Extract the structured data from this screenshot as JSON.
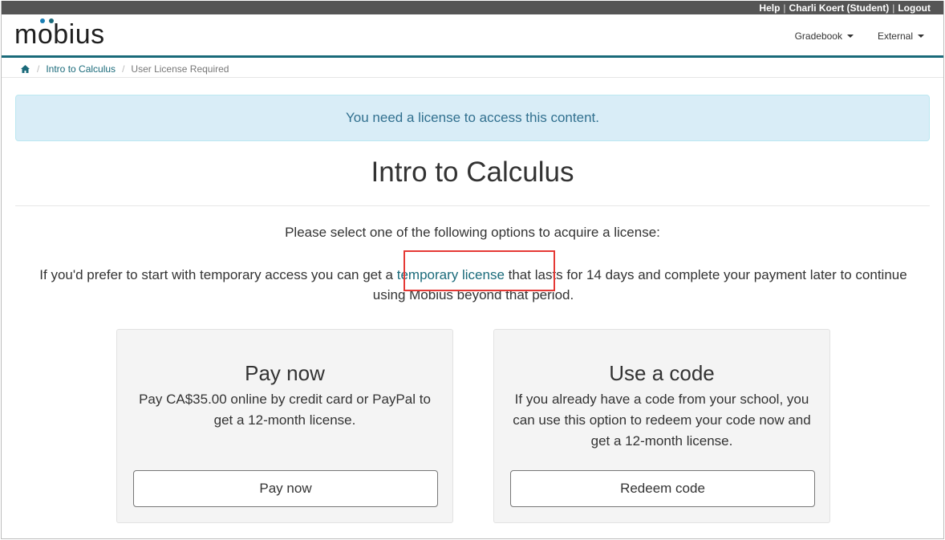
{
  "topbar": {
    "help": "Help",
    "user": "Charli Koert (Student)",
    "logout": "Logout",
    "separator": "|"
  },
  "brand": {
    "logo_text_pre": "m",
    "logo_text_o": "o",
    "logo_text_post": "bius",
    "dot_colors": [
      "#1a7fb5",
      "#1a6a7a"
    ]
  },
  "menu": {
    "gradebook": "Gradebook",
    "external": "External"
  },
  "breadcrumb": {
    "home_icon": "home-icon",
    "course": "Intro to Calculus",
    "current": "User License Required",
    "separator": "/"
  },
  "alert": {
    "message": "You need a license to access this content."
  },
  "page": {
    "title": "Intro to Calculus",
    "lead": "Please select one of the following options to acquire a license:",
    "temp_before": "If you'd prefer to start with temporary access you can get a ",
    "temp_link": "temporary license",
    "temp_after": " that lasts for 14 days and complete your payment later to continue using Möbius beyond that period."
  },
  "cards": {
    "pay": {
      "title": "Pay now",
      "text": "Pay CA$35.00 online by credit card or PayPal to get a 12-month license.",
      "button": "Pay now"
    },
    "code": {
      "title": "Use a code",
      "text": "If you already have a code from your school, you can use this option to redeem your code now and get a 12-month license.",
      "button": "Redeem code"
    }
  },
  "colors": {
    "accent": "#1a6a7a",
    "alert_bg": "#d9edf7",
    "alert_text": "#31708f",
    "highlight": "#e53935"
  }
}
